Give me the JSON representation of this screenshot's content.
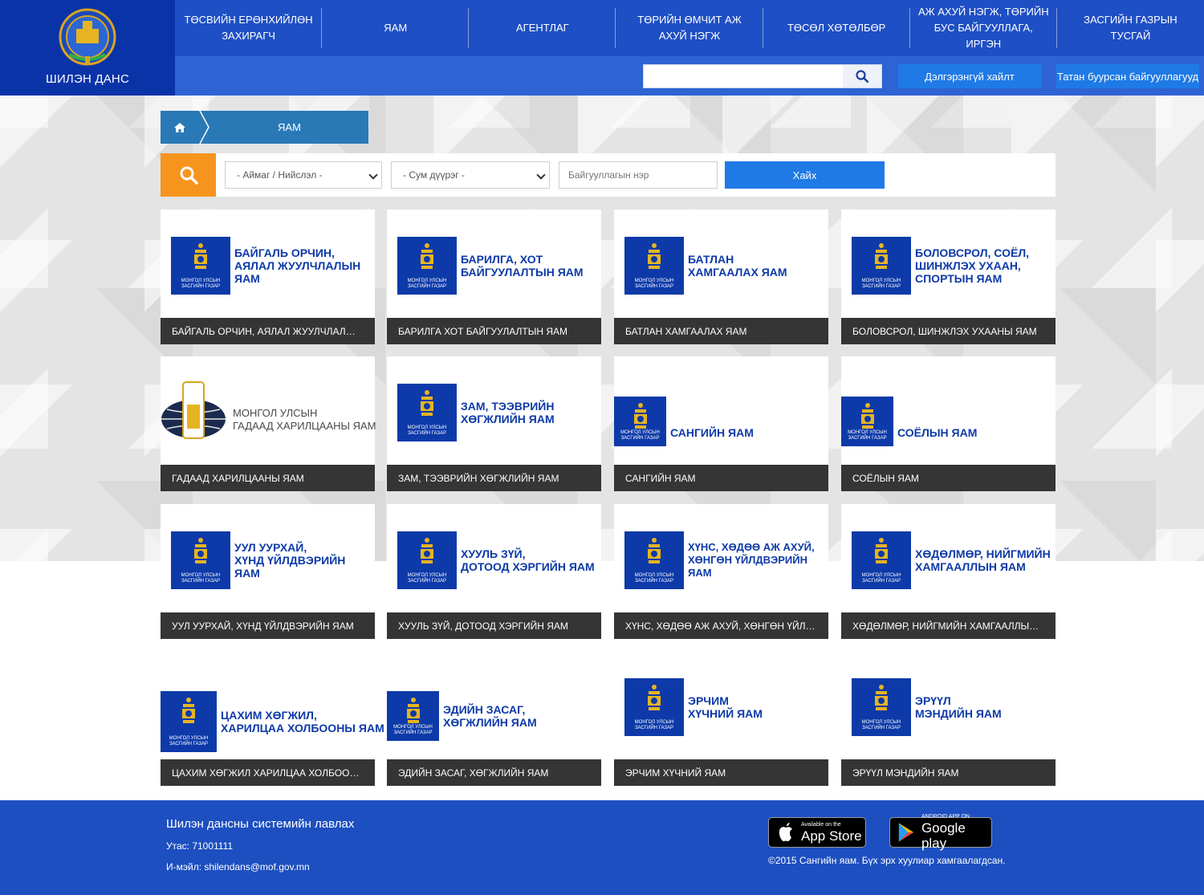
{
  "header": {
    "logo_text": "ШИЛЭН ДАНС",
    "nav": [
      "ТӨСВИЙН ЕРӨНХИЙЛӨН ЗАХИРАГЧ",
      "ЯАМ",
      "АГЕНТЛАГ",
      "ТӨРИЙН ӨМЧИТ АЖ АХУЙ НЭГЖ",
      "ТӨСӨЛ ХӨТӨЛБӨР",
      "АЖ АХУЙ НЭГЖ, ТӨРИЙН БУС БАЙГУУЛЛАГА, ИРГЭН",
      "ЗАСГИЙН ГАЗРЫН ТУСГАЙ"
    ],
    "search_placeholder": "",
    "advanced_search": "Дэлгэрэнгүй хайлт",
    "subscribed": "Татан буурсан байгууллагууд"
  },
  "breadcrumb": {
    "current": "ЯАМ"
  },
  "filter": {
    "province": "- Аймаг / Нийслэл -",
    "district": "- Сум дүүрэг -",
    "org_placeholder": "Байгууллагын нэр",
    "search_button": "Хайх"
  },
  "emblem_caption": "МОНГОЛ УЛСЫН ЗАСГИЙН ГАЗАР",
  "cards": [
    {
      "logo_lines": [
        "БАЙГАЛЬ ОРЧИН,",
        "АЯЛАЛ ЖУУЛЧЛАЛЫН",
        "ЯАМ"
      ],
      "caption": "БАЙГАЛЬ ОРЧИН, АЯЛАЛ ЖУУЛЧЛАЛЫН ЯАМ"
    },
    {
      "logo_lines": [
        "БАРИЛГА, ХОТ",
        "БАЙГУУЛАЛТЫН ЯАМ"
      ],
      "caption": "БАРИЛГА ХОТ БАЙГУУЛАЛТЫН ЯАМ"
    },
    {
      "logo_lines": [
        "БАТЛАН",
        "ХАМГААЛАХ ЯАМ"
      ],
      "caption": "БАТЛАН ХАМГААЛАХ ЯАМ"
    },
    {
      "logo_lines": [
        "БОЛОВСРОЛ, СОЁЛ,",
        "ШИНЖЛЭХ УХААН,",
        "СПОРТЫН ЯАМ"
      ],
      "caption": "БОЛОВСРОЛ, ШИНЖЛЭХ УХААНЫ ЯАМ"
    },
    {
      "logo_lines": [
        "МОНГОЛ УЛСЫН",
        "ГАДААД ХАРИЛЦААНЫ ЯАМ"
      ],
      "caption": "ГАДААД ХАРИЛЦААНЫ ЯАМ"
    },
    {
      "logo_lines": [
        "ЗАМ, ТЭЭВРИЙН",
        "ХӨГЖЛИЙН ЯАМ"
      ],
      "caption": "ЗАМ, ТЭЭВРИЙН ХӨГЖЛИЙН ЯАМ"
    },
    {
      "logo_lines": [
        "САНГИЙН ЯАМ"
      ],
      "caption": "САНГИЙН ЯАМ"
    },
    {
      "logo_lines": [
        "СОЁЛЫН ЯАМ"
      ],
      "caption": "СОЁЛЫН ЯАМ"
    },
    {
      "logo_lines": [
        "УУЛ УУРХАЙ,",
        "ХҮНД ҮЙЛДВЭРИЙН",
        "ЯАМ"
      ],
      "caption": "УУЛ УУРХАЙ, ХҮНД ҮЙЛДВЭРИЙН ЯАМ"
    },
    {
      "logo_lines": [
        "ХУУЛЬ ЗҮЙ,",
        "ДОТООД ХЭРГИЙН ЯАМ"
      ],
      "caption": "ХУУЛЬ ЗҮЙ, ДОТООД ХЭРГИЙН ЯАМ"
    },
    {
      "logo_lines": [
        "ХҮНС, ХӨДӨӨ АЖ АХУЙ,",
        "ХӨНГӨН ҮЙЛДВЭРИЙН",
        "ЯАМ"
      ],
      "caption": "ХҮНС, ХӨДӨӨ АЖ АХУЙ, ХӨНГӨН ҮЙЛДВЭРИЙН ..."
    },
    {
      "logo_lines": [
        "ХӨДӨЛМӨР, НИЙГМИЙН",
        "ХАМГААЛЛЫН ЯАМ"
      ],
      "caption": "ХӨДӨЛМӨР, НИЙГМИЙН ХАМГААЛЛЫН ЯАМ"
    },
    {
      "logo_lines": [
        "ЦАХИМ ХӨГЖИЛ,",
        "ХАРИЛЦАА ХОЛБООНЫ ЯАМ"
      ],
      "caption": "ЦАХИМ ХӨГЖИЛ ХАРИЛЦАА ХОЛБООНЫ ЯАМ"
    },
    {
      "logo_lines": [
        "ЭДИЙН ЗАСАГ,",
        "ХӨГЖЛИЙН ЯАМ"
      ],
      "caption": "ЭДИЙН ЗАСАГ, ХӨГЖЛИЙН ЯАМ"
    },
    {
      "logo_lines": [
        "ЭРЧИМ",
        "ХҮЧНИЙ ЯАМ"
      ],
      "caption": "ЭРЧИМ ХҮЧНИЙ ЯАМ"
    },
    {
      "logo_lines": [
        "ЭРҮҮЛ",
        "МЭНДИЙН ЯАМ"
      ],
      "caption": "ЭРҮҮЛ МЭНДИЙН ЯАМ"
    }
  ],
  "footer": {
    "title": "Шилэн дансны системийн лавлах",
    "phone": "Утас: 71001111",
    "email": "И-мэйл: shilendans@mof.gov.mn",
    "appstore_small": "Available on the",
    "appstore_big": "App Store",
    "gplay_small": "ANDROID APP ON",
    "gplay_big": "Google play",
    "copyright": "©2015 Сангийн яам. Бүх эрх хуулиар хамгаалагдсан."
  },
  "colors": {
    "header": "#1f4fc4",
    "logo_bg": "#0b33a8",
    "accent": "#1f7ae6",
    "orange": "#f7941d",
    "caption_bg": "#353535",
    "ministry_blue": "#0d3aa8"
  }
}
